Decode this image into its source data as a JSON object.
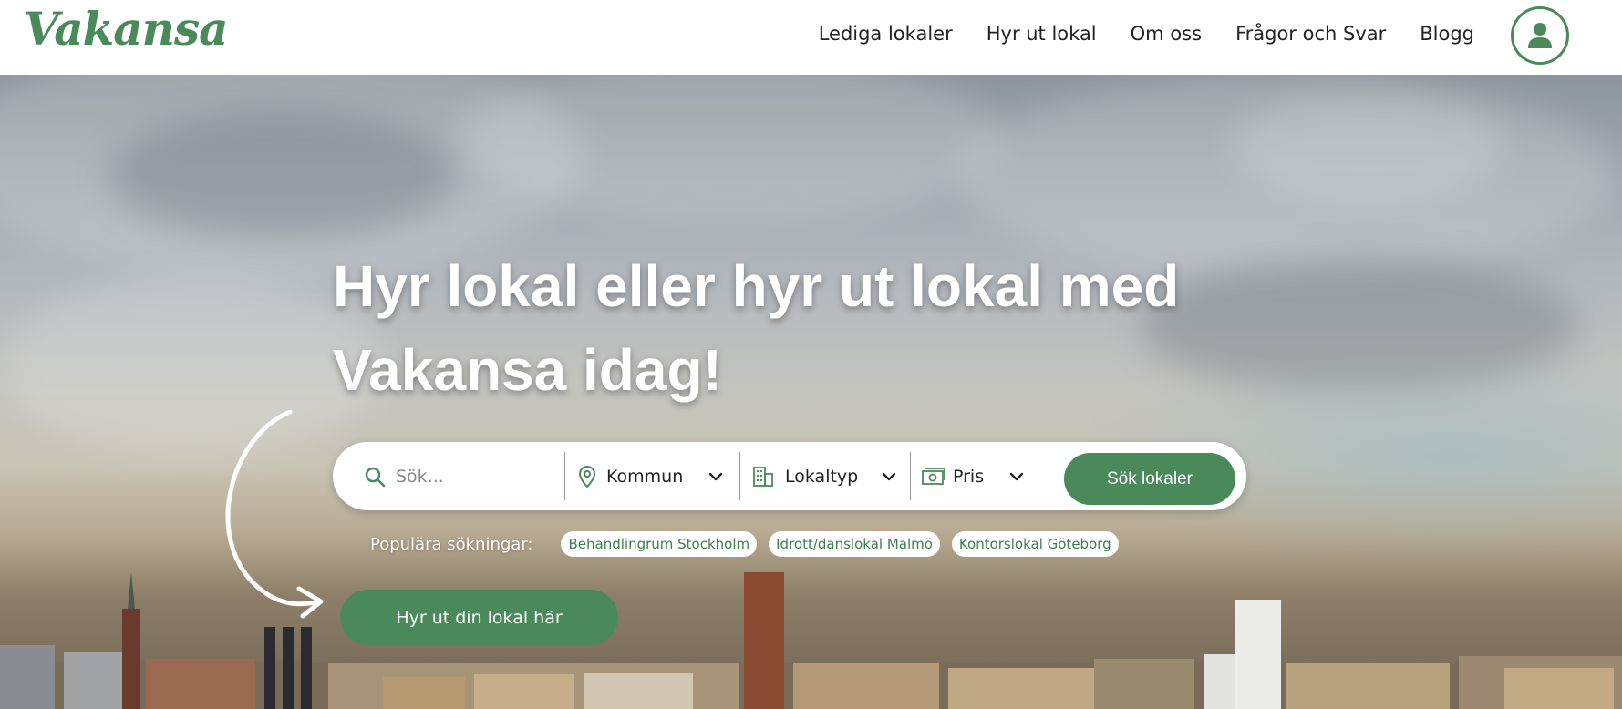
{
  "brand": {
    "logo_text": "Vakansa",
    "accent": "#4a8a5a"
  },
  "nav": {
    "items": [
      {
        "label": "Lediga lokaler"
      },
      {
        "label": "Hyr ut lokal"
      },
      {
        "label": "Om oss"
      },
      {
        "label": "Frågor och Svar"
      },
      {
        "label": "Blogg"
      }
    ],
    "account_icon": "user-icon"
  },
  "hero": {
    "title_line1": "Hyr lokal eller hyr ut lokal med",
    "title_line2": "Vakansa idag!"
  },
  "search": {
    "placeholder": "Sök...",
    "kommun_label": "Kommun",
    "lokaltyp_label": "Lokaltyp",
    "pris_label": "Pris",
    "submit_label": "Sök lokaler"
  },
  "popular": {
    "label": "Populära sökningar:",
    "chips": [
      "Behandlingrum Stockholm",
      "Idrott/danslokal Malmö",
      "Kontorslokal Göteborg"
    ]
  },
  "cta": {
    "label": "Hyr ut din lokal här"
  }
}
